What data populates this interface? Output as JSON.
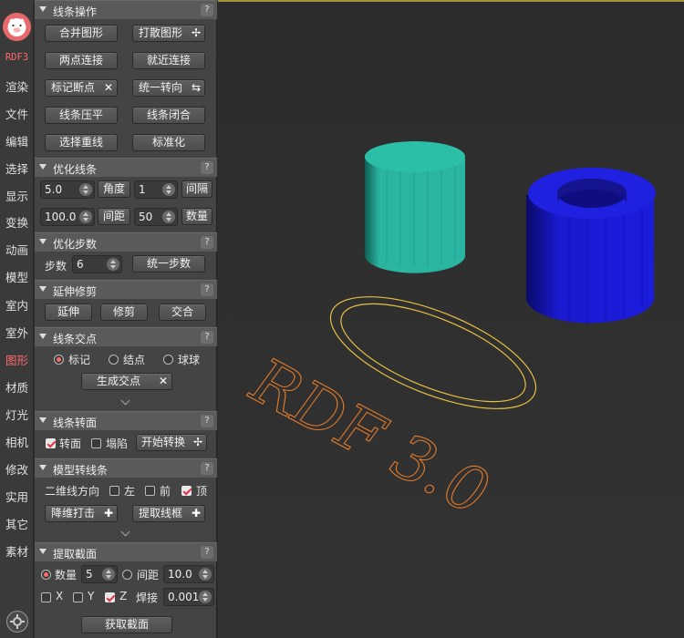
{
  "nav": {
    "rdf": "RDF3",
    "items": [
      "渲染",
      "文件",
      "编辑",
      "选择",
      "显示",
      "变换",
      "动画",
      "模型",
      "室内",
      "室外",
      "图形",
      "材质",
      "灯光",
      "相机",
      "修改",
      "实用",
      "其它",
      "素材"
    ],
    "active": "图形"
  },
  "sections": {
    "s1": {
      "title": "线条操作",
      "help": "?",
      "b1": "合并图形",
      "b2": "打散图形",
      "b3": "两点连接",
      "b4": "就近连接",
      "b5": "标记断点",
      "b6": "统一转向",
      "b7": "线条压平",
      "b8": "线条闭合",
      "b9": "选择重线",
      "b10": "标准化"
    },
    "s2": {
      "title": "优化线条",
      "help": "?",
      "v1": "5.0",
      "l1": "角度",
      "v2": "1",
      "l2": "间隔",
      "v3": "100.0",
      "l3": "间距",
      "v4": "50",
      "l4": "数量"
    },
    "s3": {
      "title": "优化步数",
      "help": "?",
      "label": "步数",
      "value": "6",
      "btn": "统一步数"
    },
    "s4": {
      "title": "延伸修剪",
      "help": "?",
      "b1": "延伸",
      "b2": "修剪",
      "b3": "交合"
    },
    "s5": {
      "title": "线条交点",
      "help": "?",
      "r1": "标记",
      "r2": "结点",
      "r3": "球球",
      "btn": "生成交点"
    },
    "s6": {
      "title": "线条转面",
      "help": "?",
      "c1": "转面",
      "c2": "塌陷",
      "btn": "开始转换"
    },
    "s7": {
      "title": "模型转线条",
      "help": "?",
      "dir": "二维线方向",
      "c1": "左",
      "c2": "前",
      "c3": "顶",
      "b1": "降维打击",
      "b2": "提取线框"
    },
    "s8": {
      "title": "提取截面",
      "help": "?",
      "r1": "数量",
      "v1": "5",
      "r2": "间距",
      "v2": "10.0",
      "x": "X",
      "y": "Y",
      "z": "Z",
      "weld": "焊接",
      "v3": "0.001",
      "btn": "获取截面"
    }
  },
  "viewport": {
    "text_3d": "RDF 3.0"
  },
  "colors": {
    "accent": "#ff6b6b",
    "teal_cylinder": "#2ab5a0",
    "blue_tube": "#1a1ad0",
    "ring": "#e8c040",
    "text3d": "#e07a2a"
  }
}
